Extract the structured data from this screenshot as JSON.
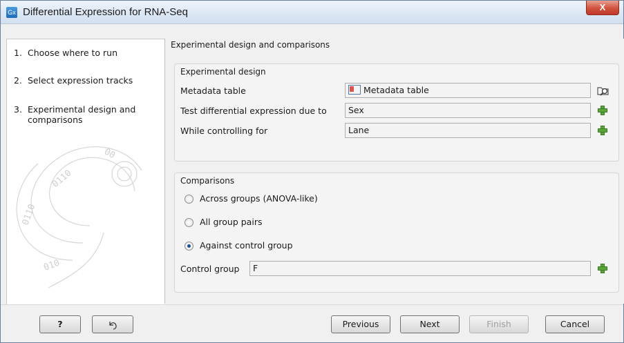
{
  "window": {
    "title": "Differential Expression for RNA-Seq",
    "app_icon_text": "Gx",
    "close_label": "X"
  },
  "steps": [
    {
      "num": "1.",
      "label": "Choose where to run"
    },
    {
      "num": "2.",
      "label": "Select expression tracks"
    },
    {
      "num": "3.",
      "label": "Experimental design and comparisons"
    }
  ],
  "main": {
    "section_title": "Experimental design and comparisons",
    "design": {
      "title": "Experimental design",
      "metadata_label": "Metadata table",
      "metadata_value": "Metadata table",
      "test_label": "Test differential expression due to",
      "test_value": "Sex",
      "control_label": "While controlling for",
      "control_value": "Lane"
    },
    "comparisons": {
      "title": "Comparisons",
      "options": [
        {
          "label": "Across groups (ANOVA-like)",
          "selected": false
        },
        {
          "label": "All group pairs",
          "selected": false
        },
        {
          "label": "Against control group",
          "selected": true
        }
      ],
      "control_group_label": "Control group",
      "control_group_value": "F"
    }
  },
  "buttons": {
    "help": "?",
    "previous": "Previous",
    "next": "Next",
    "finish": "Finish",
    "cancel": "Cancel"
  },
  "colors": {
    "accent_plus": "#5aa53a",
    "close": "#c0392b"
  }
}
